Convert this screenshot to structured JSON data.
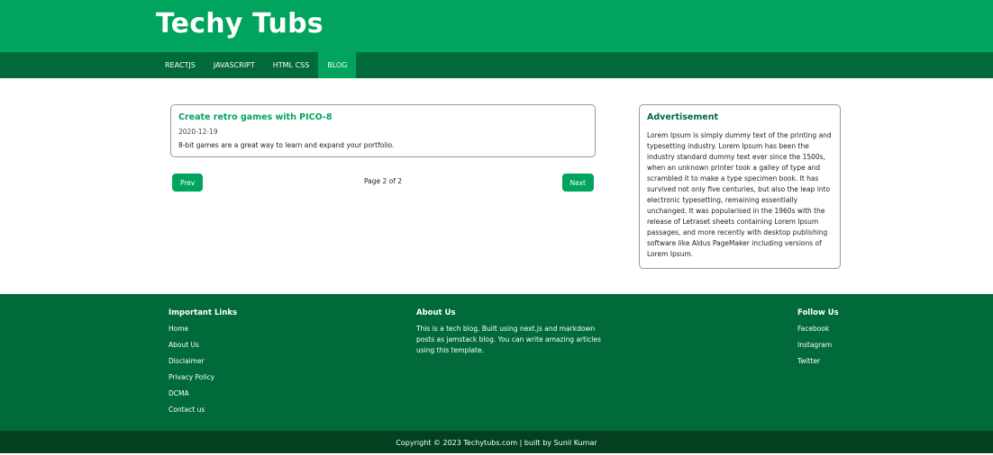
{
  "site": {
    "title": "Techy Tubs"
  },
  "nav": {
    "items": [
      {
        "label": "REACTJS"
      },
      {
        "label": "JAVASCRIPT"
      },
      {
        "label": "HTML CSS"
      },
      {
        "label": "BLOG"
      }
    ],
    "active": "BLOG"
  },
  "post": {
    "title": "Create retro games with PICO-8",
    "date": "2020-12-19",
    "excerpt": "8-bit games are a great way to learn and expand your portfolio."
  },
  "pagination": {
    "prev_label": "Prev",
    "next_label": "Next",
    "info": "Page 2 of 2"
  },
  "ad": {
    "title": "Advertisement",
    "text": "Lorem Ipsum is simply dummy text of the printing and typesetting industry. Lorem Ipsum has been the industry standard dummy text ever since the 1500s, when an unknown printer took a galley of type and scrambled it to make a type specimen book. It has survived not only five centuries, but also the leap into electronic typesetting, remaining essentially unchanged. It was popularised in the 1960s with the release of Letraset sheets containing Lorem Ipsum passages, and more recently with desktop publishing software like Aldus PageMaker including versions of Lorem Ipsum."
  },
  "footer": {
    "important_links": {
      "heading": "Important Links",
      "items": [
        {
          "label": "Home"
        },
        {
          "label": "About Us"
        },
        {
          "label": "Disclaimer"
        },
        {
          "label": "Privacy Policy"
        },
        {
          "label": "DCMA"
        },
        {
          "label": "Contact us"
        }
      ]
    },
    "about": {
      "heading": "About Us",
      "text": "This is a tech blog. Built using next.js and markdown posts as jamstack blog. You can write amazing articles using this template."
    },
    "follow": {
      "heading": "Follow Us",
      "items": [
        {
          "label": "Facebook"
        },
        {
          "label": "Instagram"
        },
        {
          "label": "Twitter"
        }
      ]
    },
    "copyright": "Copyright © 2023 Techytubs.com | built by Sunil Kumar"
  },
  "colors": {
    "primary": "#00a45c",
    "dark": "#006a3a",
    "darker": "#02401f"
  }
}
